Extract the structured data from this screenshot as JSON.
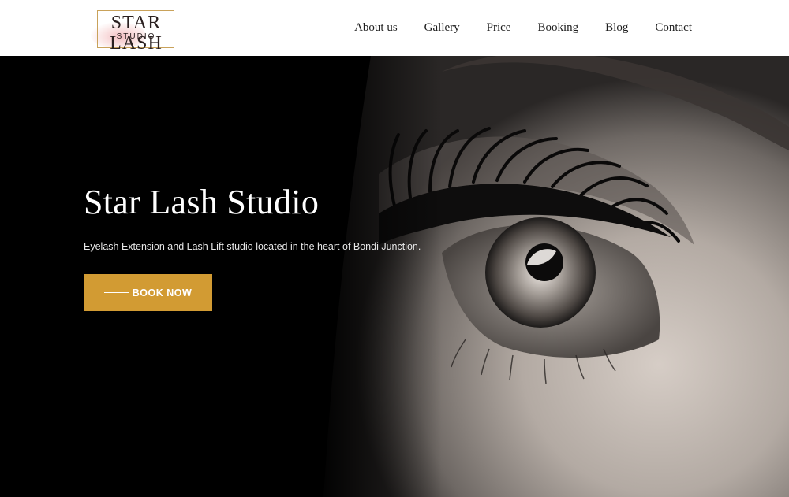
{
  "logo": {
    "main": "STAR LASH",
    "sub": "STUDIO"
  },
  "nav": {
    "items": [
      "About us",
      "Gallery",
      "Price",
      "Booking",
      "Blog",
      "Contact"
    ]
  },
  "hero": {
    "title": "Star Lash Studio",
    "subtitle": "Eyelash Extension and Lash Lift studio located in the heart of Bondi Junction.",
    "button_label": "BOOK NOW"
  },
  "colors": {
    "accent": "#d29b33",
    "header_bg": "#ffffff",
    "hero_bg": "#000000"
  }
}
